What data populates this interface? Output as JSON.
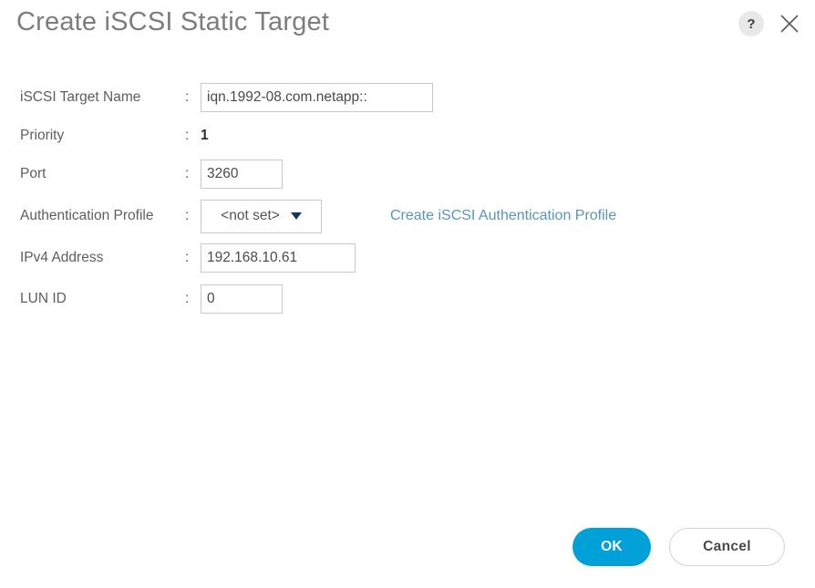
{
  "dialog": {
    "title": "Create iSCSI Static Target",
    "help_icon_label": "?",
    "close_icon_label": "×"
  },
  "form": {
    "colon": ":",
    "fields": {
      "target_name": {
        "label": "iSCSI Target Name",
        "value": "iqn.1992-08.com.netapp::"
      },
      "priority": {
        "label": "Priority",
        "value": "1"
      },
      "port": {
        "label": "Port",
        "value": "3260"
      },
      "auth_profile": {
        "label": "Authentication Profile",
        "value": "<not set>",
        "link_label": "Create iSCSI Authentication Profile"
      },
      "ipv4_address": {
        "label": "IPv4 Address",
        "value": "192.168.10.61"
      },
      "lun_id": {
        "label": "LUN ID",
        "value": "0"
      }
    }
  },
  "footer": {
    "ok_label": "OK",
    "cancel_label": "Cancel"
  },
  "colors": {
    "accent_blue": "#00a0d8",
    "link_blue": "#5b95b5",
    "title_gray": "#7d7d7d",
    "label_gray": "#5e5e5e",
    "border_gray": "#c9c9c9",
    "caret_navy": "#17365d"
  }
}
